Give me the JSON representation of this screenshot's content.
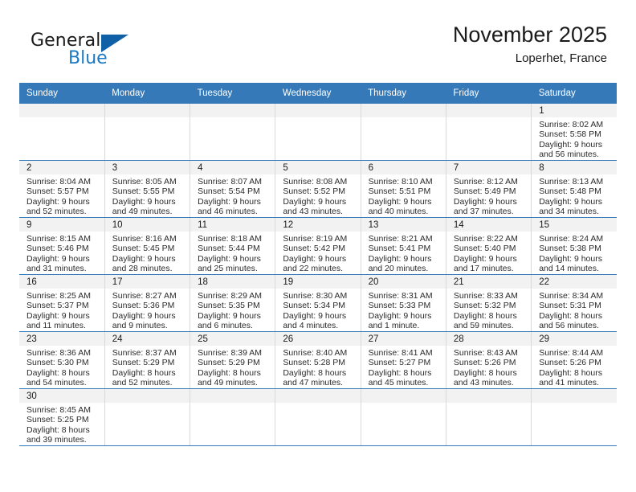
{
  "brand": {
    "name_part1": "General",
    "name_part2": "Blue",
    "triangle_color": "#1060a8",
    "blue_color": "#1a7bc4"
  },
  "header": {
    "title": "November 2025",
    "location": "Loperhet, France",
    "accent_color": "#3579b8",
    "daystrip_color": "#f2f2f2"
  },
  "weekday_headers": [
    "Sunday",
    "Monday",
    "Tuesday",
    "Wednesday",
    "Thursday",
    "Friday",
    "Saturday"
  ],
  "labels": {
    "sunrise_prefix": "Sunrise:",
    "sunset_prefix": "Sunset:",
    "daylight_prefix": "Daylight:"
  },
  "weeks": [
    [
      {
        "day": "",
        "empty": true
      },
      {
        "day": "",
        "empty": true
      },
      {
        "day": "",
        "empty": true
      },
      {
        "day": "",
        "empty": true
      },
      {
        "day": "",
        "empty": true
      },
      {
        "day": "",
        "empty": true
      },
      {
        "day": "1",
        "sunrise": "Sunrise: 8:02 AM",
        "sunset": "Sunset: 5:58 PM",
        "daylight_line1": "Daylight: 9 hours",
        "daylight_line2": "and 56 minutes."
      }
    ],
    [
      {
        "day": "2",
        "sunrise": "Sunrise: 8:04 AM",
        "sunset": "Sunset: 5:57 PM",
        "daylight_line1": "Daylight: 9 hours",
        "daylight_line2": "and 52 minutes."
      },
      {
        "day": "3",
        "sunrise": "Sunrise: 8:05 AM",
        "sunset": "Sunset: 5:55 PM",
        "daylight_line1": "Daylight: 9 hours",
        "daylight_line2": "and 49 minutes."
      },
      {
        "day": "4",
        "sunrise": "Sunrise: 8:07 AM",
        "sunset": "Sunset: 5:54 PM",
        "daylight_line1": "Daylight: 9 hours",
        "daylight_line2": "and 46 minutes."
      },
      {
        "day": "5",
        "sunrise": "Sunrise: 8:08 AM",
        "sunset": "Sunset: 5:52 PM",
        "daylight_line1": "Daylight: 9 hours",
        "daylight_line2": "and 43 minutes."
      },
      {
        "day": "6",
        "sunrise": "Sunrise: 8:10 AM",
        "sunset": "Sunset: 5:51 PM",
        "daylight_line1": "Daylight: 9 hours",
        "daylight_line2": "and 40 minutes."
      },
      {
        "day": "7",
        "sunrise": "Sunrise: 8:12 AM",
        "sunset": "Sunset: 5:49 PM",
        "daylight_line1": "Daylight: 9 hours",
        "daylight_line2": "and 37 minutes."
      },
      {
        "day": "8",
        "sunrise": "Sunrise: 8:13 AM",
        "sunset": "Sunset: 5:48 PM",
        "daylight_line1": "Daylight: 9 hours",
        "daylight_line2": "and 34 minutes."
      }
    ],
    [
      {
        "day": "9",
        "sunrise": "Sunrise: 8:15 AM",
        "sunset": "Sunset: 5:46 PM",
        "daylight_line1": "Daylight: 9 hours",
        "daylight_line2": "and 31 minutes."
      },
      {
        "day": "10",
        "sunrise": "Sunrise: 8:16 AM",
        "sunset": "Sunset: 5:45 PM",
        "daylight_line1": "Daylight: 9 hours",
        "daylight_line2": "and 28 minutes."
      },
      {
        "day": "11",
        "sunrise": "Sunrise: 8:18 AM",
        "sunset": "Sunset: 5:44 PM",
        "daylight_line1": "Daylight: 9 hours",
        "daylight_line2": "and 25 minutes."
      },
      {
        "day": "12",
        "sunrise": "Sunrise: 8:19 AM",
        "sunset": "Sunset: 5:42 PM",
        "daylight_line1": "Daylight: 9 hours",
        "daylight_line2": "and 22 minutes."
      },
      {
        "day": "13",
        "sunrise": "Sunrise: 8:21 AM",
        "sunset": "Sunset: 5:41 PM",
        "daylight_line1": "Daylight: 9 hours",
        "daylight_line2": "and 20 minutes."
      },
      {
        "day": "14",
        "sunrise": "Sunrise: 8:22 AM",
        "sunset": "Sunset: 5:40 PM",
        "daylight_line1": "Daylight: 9 hours",
        "daylight_line2": "and 17 minutes."
      },
      {
        "day": "15",
        "sunrise": "Sunrise: 8:24 AM",
        "sunset": "Sunset: 5:38 PM",
        "daylight_line1": "Daylight: 9 hours",
        "daylight_line2": "and 14 minutes."
      }
    ],
    [
      {
        "day": "16",
        "sunrise": "Sunrise: 8:25 AM",
        "sunset": "Sunset: 5:37 PM",
        "daylight_line1": "Daylight: 9 hours",
        "daylight_line2": "and 11 minutes."
      },
      {
        "day": "17",
        "sunrise": "Sunrise: 8:27 AM",
        "sunset": "Sunset: 5:36 PM",
        "daylight_line1": "Daylight: 9 hours",
        "daylight_line2": "and 9 minutes."
      },
      {
        "day": "18",
        "sunrise": "Sunrise: 8:29 AM",
        "sunset": "Sunset: 5:35 PM",
        "daylight_line1": "Daylight: 9 hours",
        "daylight_line2": "and 6 minutes."
      },
      {
        "day": "19",
        "sunrise": "Sunrise: 8:30 AM",
        "sunset": "Sunset: 5:34 PM",
        "daylight_line1": "Daylight: 9 hours",
        "daylight_line2": "and 4 minutes."
      },
      {
        "day": "20",
        "sunrise": "Sunrise: 8:31 AM",
        "sunset": "Sunset: 5:33 PM",
        "daylight_line1": "Daylight: 9 hours",
        "daylight_line2": "and 1 minute."
      },
      {
        "day": "21",
        "sunrise": "Sunrise: 8:33 AM",
        "sunset": "Sunset: 5:32 PM",
        "daylight_line1": "Daylight: 8 hours",
        "daylight_line2": "and 59 minutes."
      },
      {
        "day": "22",
        "sunrise": "Sunrise: 8:34 AM",
        "sunset": "Sunset: 5:31 PM",
        "daylight_line1": "Daylight: 8 hours",
        "daylight_line2": "and 56 minutes."
      }
    ],
    [
      {
        "day": "23",
        "sunrise": "Sunrise: 8:36 AM",
        "sunset": "Sunset: 5:30 PM",
        "daylight_line1": "Daylight: 8 hours",
        "daylight_line2": "and 54 minutes."
      },
      {
        "day": "24",
        "sunrise": "Sunrise: 8:37 AM",
        "sunset": "Sunset: 5:29 PM",
        "daylight_line1": "Daylight: 8 hours",
        "daylight_line2": "and 52 minutes."
      },
      {
        "day": "25",
        "sunrise": "Sunrise: 8:39 AM",
        "sunset": "Sunset: 5:29 PM",
        "daylight_line1": "Daylight: 8 hours",
        "daylight_line2": "and 49 minutes."
      },
      {
        "day": "26",
        "sunrise": "Sunrise: 8:40 AM",
        "sunset": "Sunset: 5:28 PM",
        "daylight_line1": "Daylight: 8 hours",
        "daylight_line2": "and 47 minutes."
      },
      {
        "day": "27",
        "sunrise": "Sunrise: 8:41 AM",
        "sunset": "Sunset: 5:27 PM",
        "daylight_line1": "Daylight: 8 hours",
        "daylight_line2": "and 45 minutes."
      },
      {
        "day": "28",
        "sunrise": "Sunrise: 8:43 AM",
        "sunset": "Sunset: 5:26 PM",
        "daylight_line1": "Daylight: 8 hours",
        "daylight_line2": "and 43 minutes."
      },
      {
        "day": "29",
        "sunrise": "Sunrise: 8:44 AM",
        "sunset": "Sunset: 5:26 PM",
        "daylight_line1": "Daylight: 8 hours",
        "daylight_line2": "and 41 minutes."
      }
    ],
    [
      {
        "day": "30",
        "sunrise": "Sunrise: 8:45 AM",
        "sunset": "Sunset: 5:25 PM",
        "daylight_line1": "Daylight: 8 hours",
        "daylight_line2": "and 39 minutes."
      },
      {
        "day": "",
        "empty": true
      },
      {
        "day": "",
        "empty": true
      },
      {
        "day": "",
        "empty": true
      },
      {
        "day": "",
        "empty": true
      },
      {
        "day": "",
        "empty": true
      },
      {
        "day": "",
        "empty": true
      }
    ]
  ]
}
